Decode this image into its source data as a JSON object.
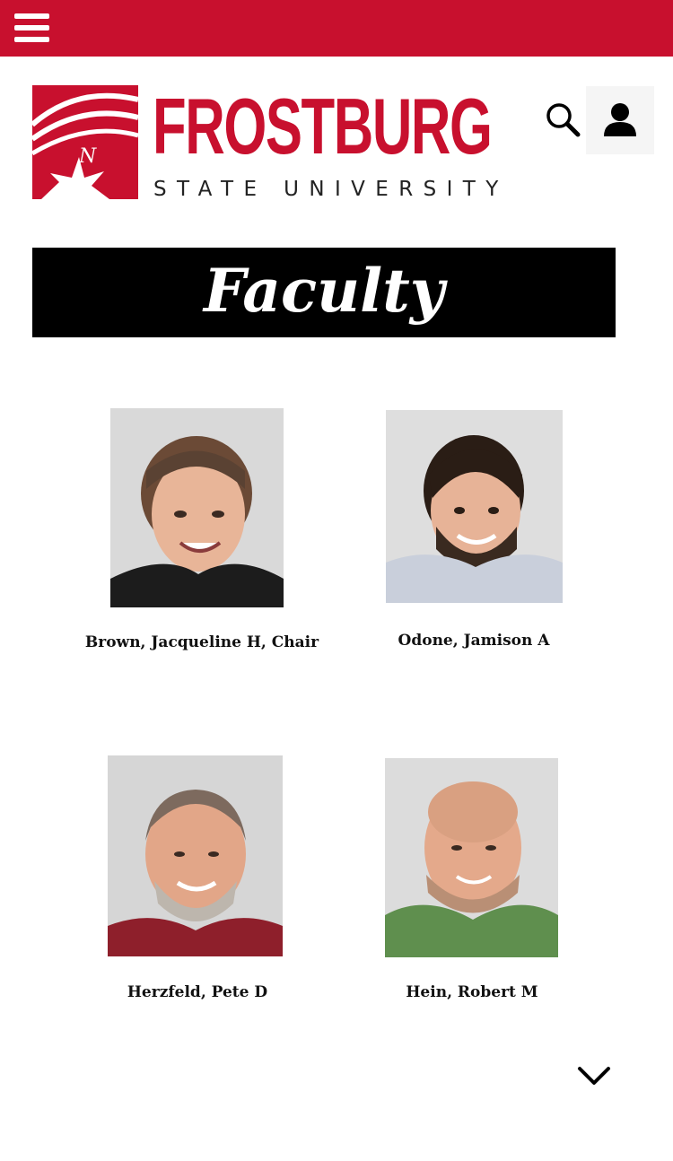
{
  "header": {
    "menu_icon": "hamburger-menu-icon",
    "brand_color": "#c8102e",
    "logo_word": "FROSTBURG",
    "logo_subtitle": "STATE UNIVERSITY",
    "logo_mark_letter": "N",
    "search_icon": "search-icon",
    "user_icon": "user-icon"
  },
  "banner": {
    "title": "Faculty"
  },
  "faculty": [
    {
      "name": "Brown, Jacqueline H, Chair",
      "shirt_color": "#1c1c1c",
      "hair_color": "#5a4233"
    },
    {
      "name": "Odone, Jamison A",
      "shirt_color": "#c9cfdb",
      "hair_color": "#2a1d15"
    },
    {
      "name": "Herzfeld, Pete D",
      "shirt_color": "#8e1f2b",
      "hair_color": "#7d6a5e"
    },
    {
      "name": "Hein, Robert M",
      "shirt_color": "#5f8f4e",
      "hair_color": "#b98f75"
    }
  ],
  "scroll_icon": "chevron-down-icon"
}
